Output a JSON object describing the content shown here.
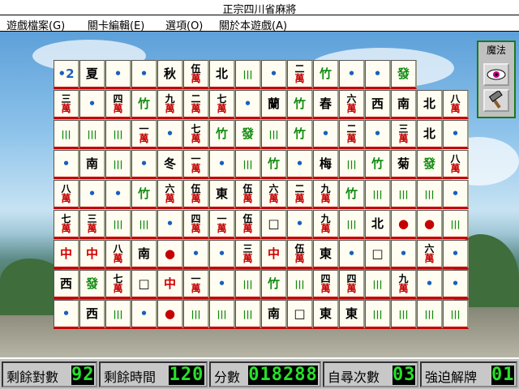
{
  "window": {
    "title": "正宗四川省麻將"
  },
  "menu": [
    {
      "label": "遊戲檔案(G)"
    },
    {
      "label": "關卡編輯(E)"
    },
    {
      "label": "選項(O)"
    },
    {
      "label": "關於本遊戲(A)"
    }
  ],
  "magic_panel": {
    "label": "魔法",
    "buttons": [
      {
        "icon": "eye-icon"
      },
      {
        "icon": "hammer-icon"
      }
    ]
  },
  "colors": {
    "led": "#27e02a",
    "tile_edge": "#c40000",
    "panel_border": "#1b7a1b"
  },
  "board": {
    "rows": [
      [
        "•2",
        "夏",
        "•",
        "•",
        "秋",
        "伍萬",
        "北",
        "|||",
        "•",
        "二萬",
        "竹",
        "•",
        "•",
        "發"
      ],
      [
        "三萬",
        "•",
        "四萬",
        "竹",
        "九萬",
        "二萬",
        "七萬",
        "•",
        "蘭",
        "竹",
        "春",
        "六萬",
        "西",
        "南",
        "北",
        "八萬"
      ],
      [
        "|||",
        "|||",
        "|||",
        "一萬",
        "•",
        "七萬",
        "竹",
        "發",
        "|||",
        "竹",
        "•",
        "二萬",
        "•",
        "三萬",
        "北",
        "•"
      ],
      [
        "•",
        "南",
        "|||",
        "•",
        "冬",
        "一萬",
        "•",
        "|||",
        "竹",
        "•",
        "梅",
        "|||",
        "竹",
        "菊",
        "發",
        "八萬"
      ],
      [
        "八萬",
        "•",
        "•",
        "竹",
        "六萬",
        "伍萬",
        "東",
        "伍萬",
        "六萬",
        "二萬",
        "九萬",
        "竹",
        "|||",
        "|||",
        "|||",
        "•"
      ],
      [
        "七萬",
        "三萬",
        "|||",
        "|||",
        "•",
        "四萬",
        "一萬",
        "伍萬",
        "□",
        "•",
        "九萬",
        "|||",
        "北",
        "●",
        "●",
        "|||"
      ],
      [
        "中",
        "中",
        "八萬",
        "南",
        "●",
        "•",
        "•",
        "三萬",
        "中",
        "伍萬",
        "東",
        "•",
        "□",
        "•",
        "六萬",
        "•"
      ],
      [
        "西",
        "發",
        "七萬",
        "□",
        "中",
        "一萬",
        "•",
        "|||",
        "竹",
        "|||",
        "四萬",
        "四萬",
        "|||",
        "九萬",
        "•",
        "•"
      ],
      [
        "•",
        "西",
        "|||",
        "•",
        "●",
        "|||",
        "|||",
        "|||",
        "南",
        "□",
        "東",
        "東",
        "|||",
        "|||",
        "|||",
        "|||"
      ]
    ]
  },
  "status": {
    "pairs_left_label": "剩餘對數",
    "pairs_left": "92",
    "time_left_label": "剩餘時間",
    "time_left": "120",
    "score_label": "分數",
    "score": "018288",
    "hints_label": "自尋次數",
    "hints": "03",
    "shuffle_label": "強迫解牌",
    "shuffle": "01"
  }
}
